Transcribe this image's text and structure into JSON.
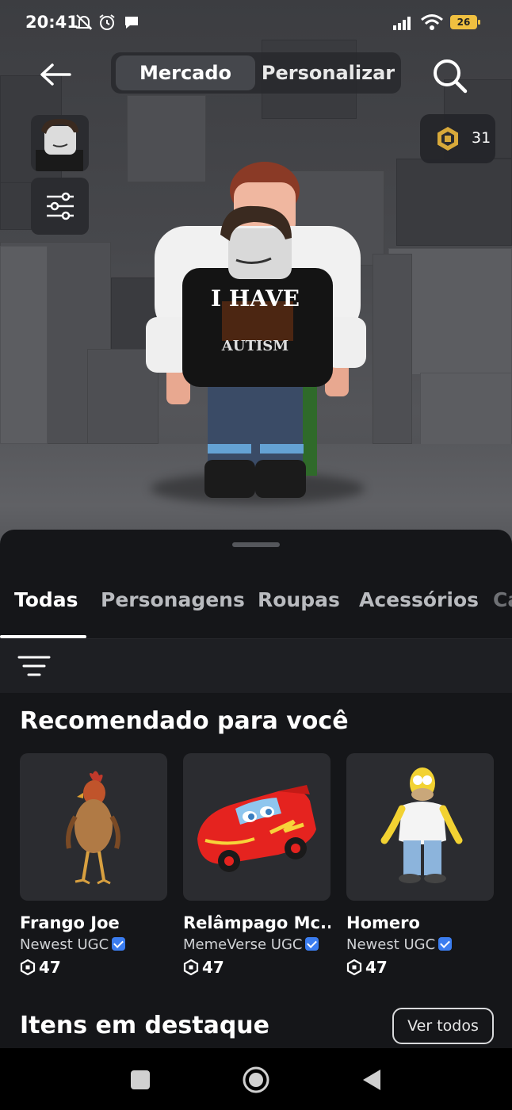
{
  "status_bar": {
    "time": "20:41",
    "battery": "26",
    "icons": [
      "mute-bell-icon",
      "alarm-icon",
      "chat-bubble-icon",
      "signal-icon",
      "wifi-icon",
      "battery-icon"
    ]
  },
  "header": {
    "segment_active": "Mercado",
    "segment_inactive": "Personalizar",
    "robux_amount": "31"
  },
  "avatar_shirt": {
    "line1": "I HAVE",
    "line2": "AUTISM"
  },
  "tabs": [
    "Todas",
    "Personagens",
    "Roupas",
    "Acessórios",
    "Ca"
  ],
  "recommended": {
    "title": "Recomendado para você",
    "items": [
      {
        "name": "Frango Joe",
        "creator": "Newest UGC",
        "price": "47"
      },
      {
        "name": "Relâmpago Mc...",
        "creator": "MemeVerse UGC",
        "price": "47"
      },
      {
        "name": "Homero",
        "creator": "Newest UGC",
        "price": "47"
      }
    ]
  },
  "featured": {
    "title": "Itens em destaque",
    "view_all": "Ver todos"
  },
  "colors": {
    "background": "#151619",
    "card": "#2b2c30",
    "accent_verified": "#3b7df0",
    "robux_gold": "#d8a93a"
  }
}
